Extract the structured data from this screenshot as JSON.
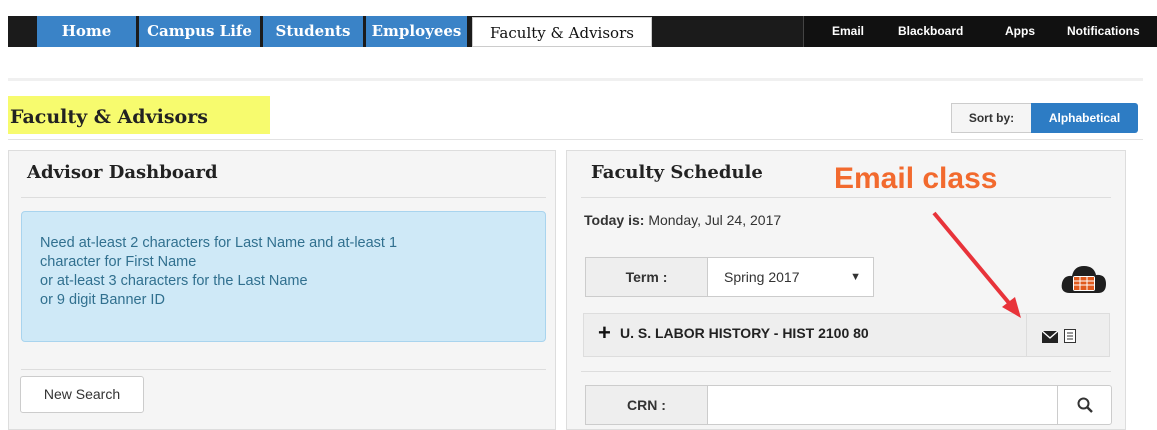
{
  "nav": {
    "tabs": [
      {
        "label": "Home"
      },
      {
        "label": "Campus Life"
      },
      {
        "label": "Students"
      },
      {
        "label": "Employees"
      },
      {
        "label": "Faculty & Advisors"
      }
    ],
    "right_links": [
      "Email",
      "Blackboard",
      "Apps",
      "Notifications"
    ]
  },
  "page": {
    "title": "Faculty & Advisors",
    "sort_label": "Sort by:",
    "sort_value": "Alphabetical"
  },
  "advisor": {
    "heading": "Advisor Dashboard",
    "message_lines": [
      "Need at-least 2 characters for Last Name and at-least 1",
      "character for First Name",
      "or at-least 3 characters for the Last Name",
      "or 9 digit Banner ID"
    ],
    "new_search": "New Search"
  },
  "schedule": {
    "heading": "Faculty Schedule",
    "today_label": "Today is:",
    "today_value": "Monday, Jul 24, 2017",
    "term_label": "Term :",
    "term_value": "Spring 2017",
    "course": "U. S. LABOR HISTORY - HIST 2100 80",
    "crn_label": "CRN :",
    "crn_value": ""
  },
  "annotation": {
    "text": "Email class"
  },
  "colors": {
    "nav_blue": "#3a83c7",
    "nav_dark": "#1b1b1b",
    "highlight": "#f7fb6e",
    "sort_blue": "#2d7cc4",
    "alert_bg": "#cfe9f7",
    "annotation": "#f26a2e",
    "arrow": "#e8333a"
  },
  "icons": [
    "plus-icon",
    "envelope-icon",
    "list-icon",
    "calendar-cloud-icon",
    "search-icon",
    "caret-down-icon"
  ]
}
